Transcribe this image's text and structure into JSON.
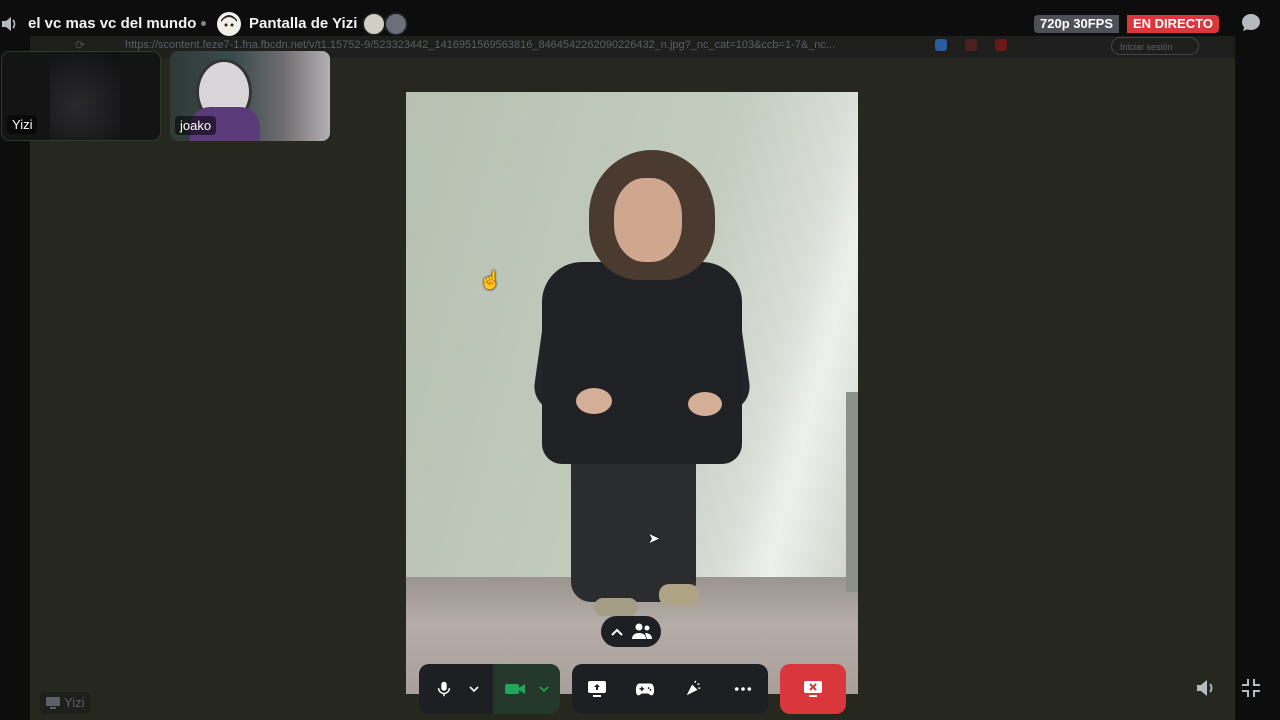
{
  "header": {
    "channel_name": "el vc mas vc del mundo",
    "screen_title": "Pantalla de Yizi",
    "quality": "720p 30FPS",
    "live_label": "EN DIRECTO"
  },
  "browser": {
    "url": "https://scontent.feze7-1.fna.fbcdn.net/v/t1.15752-9/523323442_1416951569563816_8464542262090226432_n.jpg?_nc_cat=103&ccb=1-7&_nc...",
    "signin_label": "Iniciar sesión"
  },
  "participants": [
    {
      "name": "Yizi"
    },
    {
      "name": "joako"
    }
  ],
  "footer": {
    "streamer_name": "Yizi"
  },
  "colors": {
    "live": "#da373c",
    "leave": "#da373c",
    "camera_on": "#23a55a",
    "panel": "#1e1f22"
  },
  "icons": {
    "speaker": "speaker-icon",
    "chat": "chat-bubble-icon",
    "mic": "microphone-icon",
    "camera": "video-camera-icon",
    "share": "screen-share-icon",
    "activity": "game-controller-icon",
    "soundboard": "soundboard-icon",
    "more": "more-icon",
    "leave": "leave-stream-icon",
    "volume": "volume-icon",
    "fullscreen": "exit-fullscreen-icon"
  }
}
